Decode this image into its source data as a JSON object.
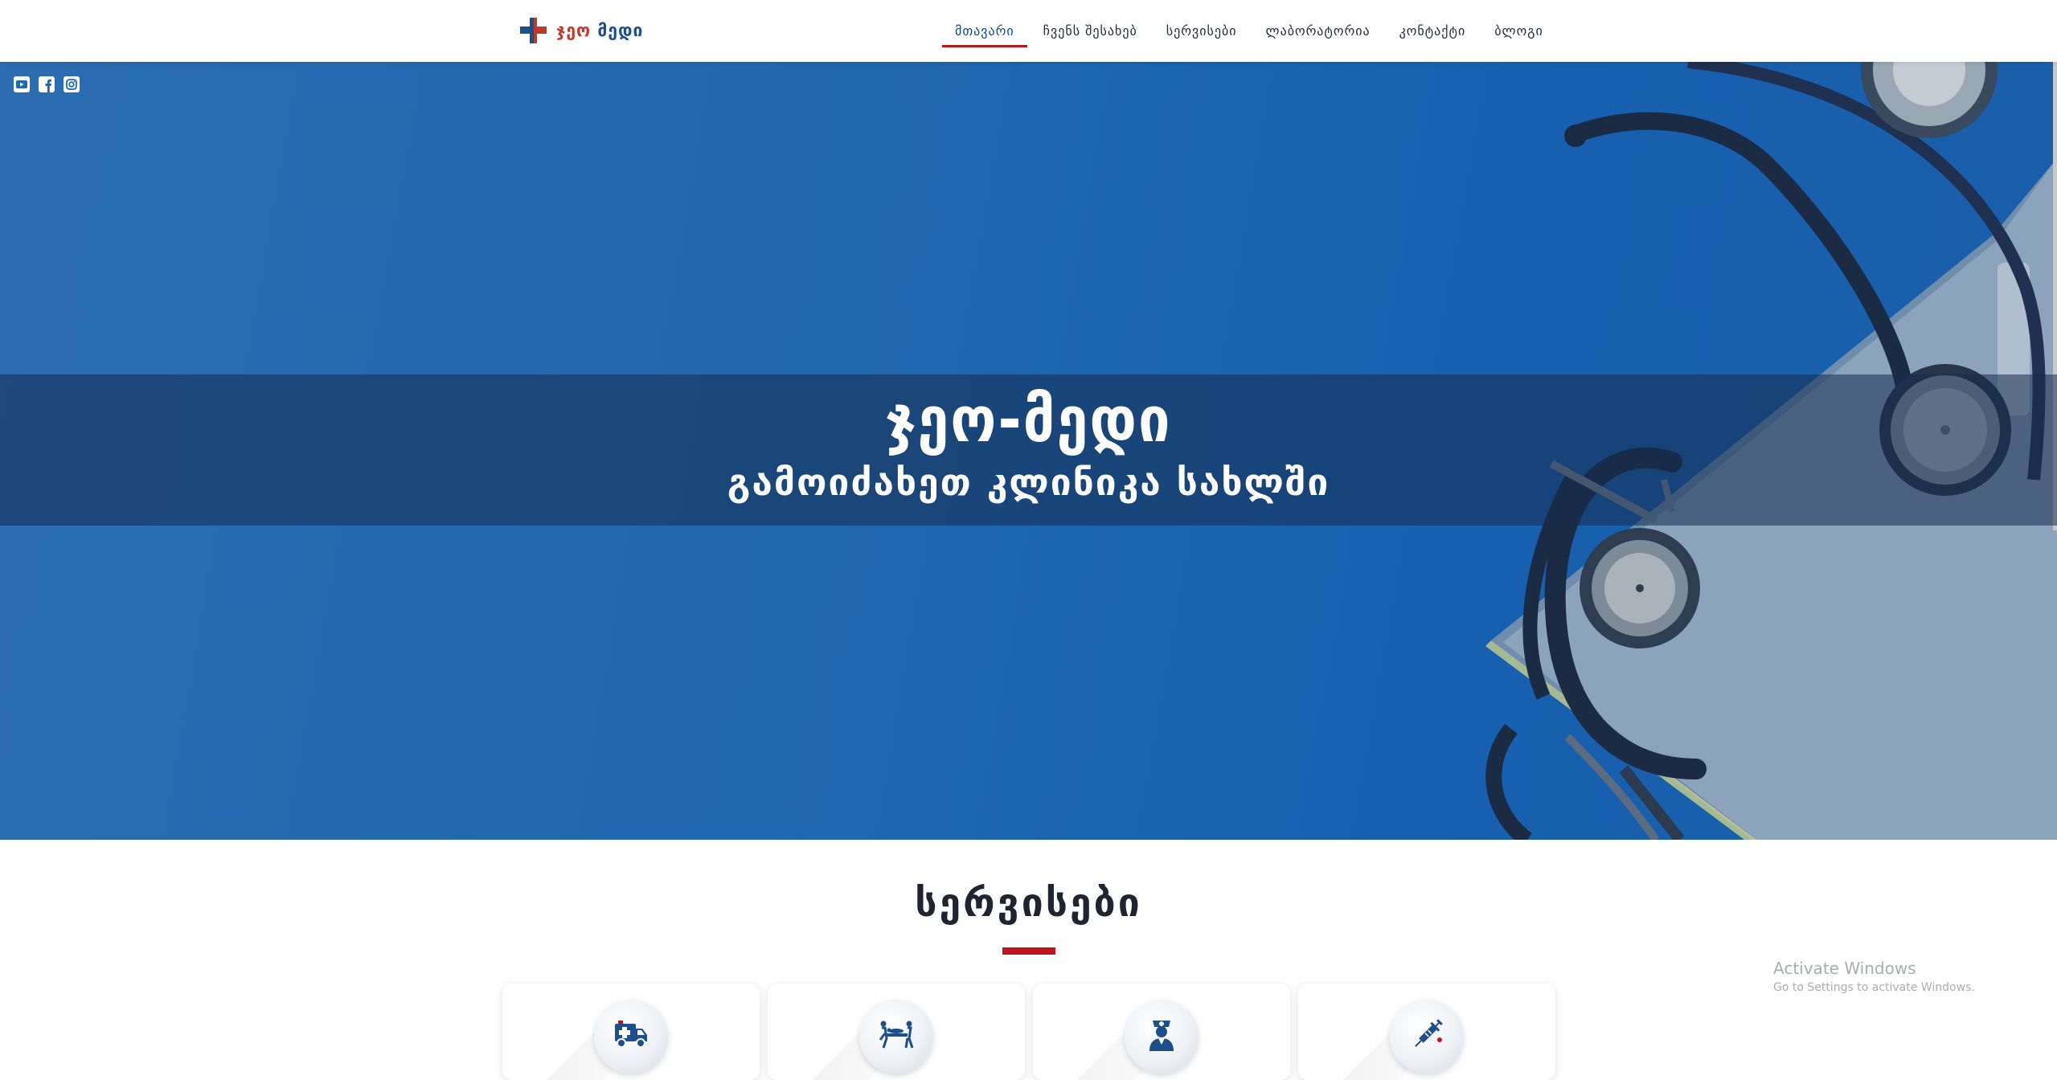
{
  "header": {
    "logo": {
      "text_red": "ჯეო",
      "text_blue": "მედი"
    },
    "nav": [
      {
        "label": "მთავარი",
        "active": true
      },
      {
        "label": "ჩვენს შესახებ",
        "active": false
      },
      {
        "label": "სერვისები",
        "active": false
      },
      {
        "label": "ლაბორატორია",
        "active": false
      },
      {
        "label": "კონტაქტი",
        "active": false
      },
      {
        "label": "ბლოგი",
        "active": false
      }
    ],
    "accent_color": "#c0141b",
    "brand_color": "#1c4f8c"
  },
  "hero": {
    "social_icons": [
      "youtube-icon",
      "facebook-icon",
      "instagram-icon"
    ],
    "title": "ჯეო-მედი",
    "subtitle": "გამოიძახეთ კლინიკა სახლში",
    "background_color": "#1f67b0"
  },
  "services": {
    "title": "სერვისები",
    "cards": [
      {
        "icon": "ambulance-icon"
      },
      {
        "icon": "stretcher-icon"
      },
      {
        "icon": "nurse-icon"
      },
      {
        "icon": "syringe-icon"
      }
    ]
  },
  "system_watermark": {
    "line1": "Activate Windows",
    "line2": "Go to Settings to activate Windows."
  }
}
